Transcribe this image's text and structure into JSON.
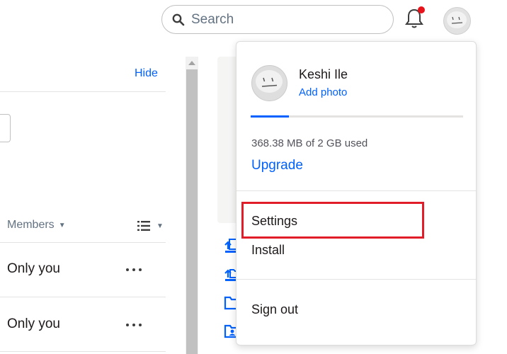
{
  "header": {
    "search_placeholder": "Search",
    "notification_badge_color": "#e8121a"
  },
  "left_panel": {
    "hide_label": "Hide",
    "members_header": "Members",
    "rows": [
      {
        "sharing": "Only you"
      },
      {
        "sharing": "Only you"
      }
    ]
  },
  "account_menu": {
    "user_name": "Keshi Ile",
    "add_photo_label": "Add photo",
    "storage_used_text": "368.38 MB of 2 GB used",
    "storage_used_fraction": 0.18,
    "upgrade_label": "Upgrade",
    "items": [
      {
        "label": "Settings"
      },
      {
        "label": "Install"
      },
      {
        "label": "Sign out"
      }
    ]
  },
  "colors": {
    "accent": "#0061fe",
    "highlight": "#e11d2a"
  }
}
